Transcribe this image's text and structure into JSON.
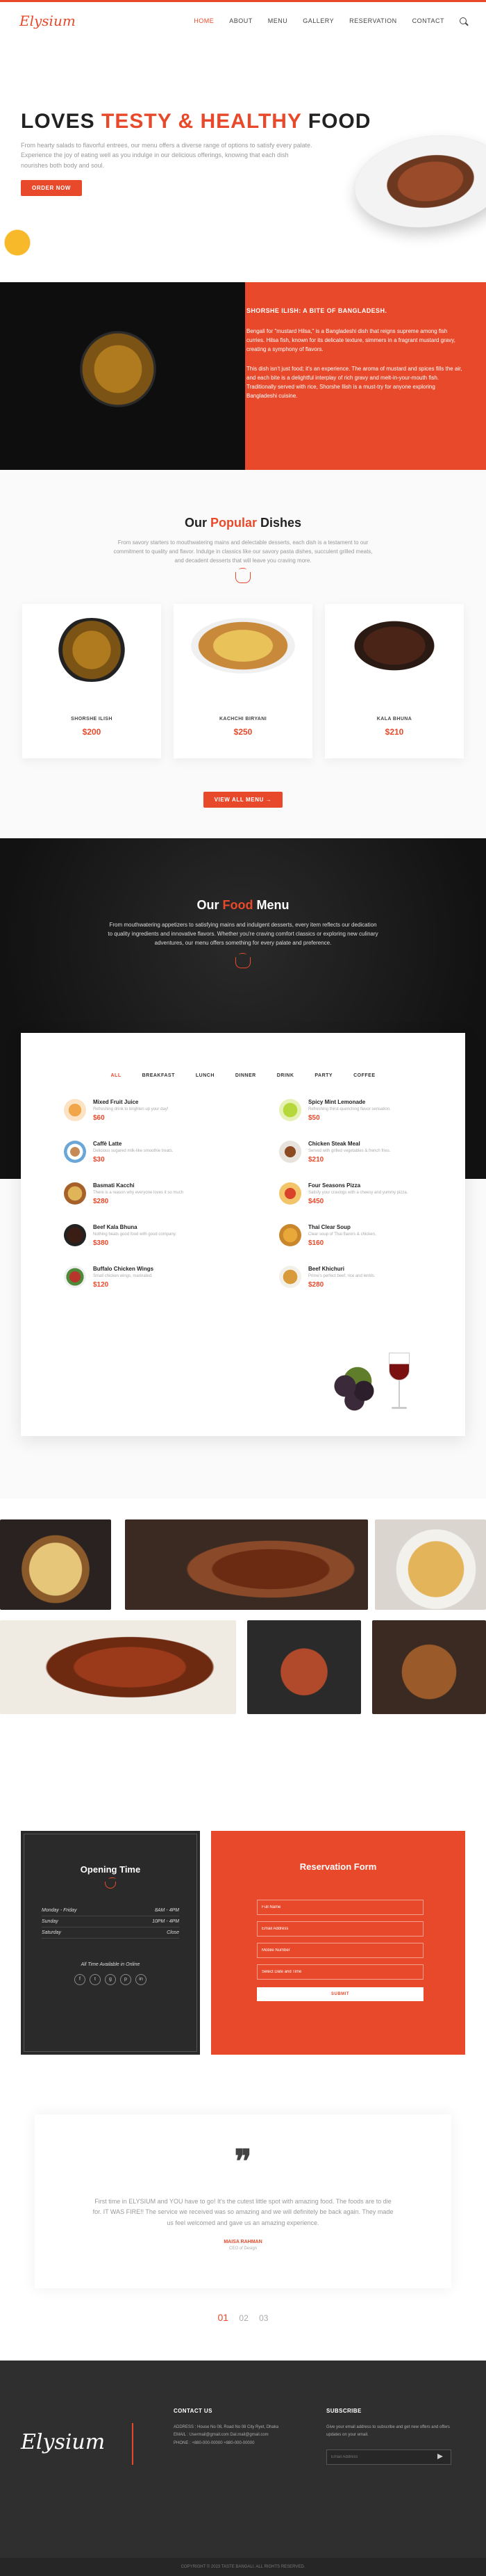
{
  "brand": {
    "logo": "Elysium"
  },
  "nav": {
    "items": [
      "HOME",
      "ABOUT",
      "MENU",
      "GALLERY",
      "RESERVATION",
      "CONTACT"
    ]
  },
  "hero": {
    "title_a": "LOVES ",
    "title_b": "TESTY & HEALTHY",
    "title_c": " FOOD",
    "text": "From hearty salads to flavorful entrees, our menu offers a diverse range of options to satisfy every palate. Experience the joy of eating well as you indulge in our delicious offerings, knowing that each dish nourishes both body and soul.",
    "button": "ORDER NOW"
  },
  "feature": {
    "title": "SHORSHE ILISH: A BITE OF BANGLADESH.",
    "p1": "Bengali for \"mustard Hilsa,\" is a Bangladeshi dish that reigns supreme among fish curries. Hilsa fish, known for its delicate texture, simmers in a fragrant mustard gravy, creating a symphony of flavors.",
    "p2": "This dish isn't just food; it's an experience. The aroma of mustard and spices fills the air, and each bite is a delightful interplay of rich gravy and melt-in-your-mouth fish. Traditionally served with rice, Shorshe Ilish is a must-try for anyone exploring Bangladeshi cuisine."
  },
  "popular": {
    "title_a": "Our ",
    "title_b": "Popular",
    "title_c": " Dishes",
    "desc": "From savory starters to mouthwatering mains and delectable desserts, each dish is a testament to our commitment to quality and flavor. Indulge in classics like our savory pasta dishes, succulent grilled meats, and decadent desserts that will leave you craving more.",
    "dishes": [
      {
        "name": "SHORSHE ILISH",
        "price": "$200"
      },
      {
        "name": "KACHCHI BIRYANI",
        "price": "$250"
      },
      {
        "name": "KALA BHUNA",
        "price": "$210"
      }
    ],
    "button": "VIEW ALL MENU →"
  },
  "food_menu": {
    "title_a": "Our ",
    "title_b": "Food",
    "title_c": " Menu",
    "desc": "From mouthwatering appetizers to satisfying mains and indulgent desserts, every item reflects our dedication to quality ingredients and innovative flavors. Whether you're craving comfort classics or exploring new culinary adventures, our menu offers something for every palate and preference.",
    "tabs": [
      "ALL",
      "BREAKFAST",
      "LUNCH",
      "DINNER",
      "DRINK",
      "PARTY",
      "COFFEE"
    ],
    "items": [
      {
        "name": "Mixed Fruit Juice",
        "desc": "Refreshing drink to brighten up your day!",
        "price": "$60"
      },
      {
        "name": "Spicy Mint Lemonade",
        "desc": "Refreshing thirst-quenching flavor sensation.",
        "price": "$50"
      },
      {
        "name": "Caffè Latte",
        "desc": "Delicious sugared milk-like smoothie treats.",
        "price": "$30"
      },
      {
        "name": "Chicken Steak Meal",
        "desc": "Served with grilled vegetables & french fries.",
        "price": "$210"
      },
      {
        "name": "Basmati Kacchi",
        "desc": "There is a reason why everyone loves it so much",
        "price": "$280"
      },
      {
        "name": "Four Seasons Pizza",
        "desc": "Satisfy your cravings with a cheesy and yummy pizza.",
        "price": "$450"
      },
      {
        "name": "Beef Kala Bhuna",
        "desc": "Nothing beats good food with good company.",
        "price": "$380"
      },
      {
        "name": "Thai Clear Soup",
        "desc": "Clear soup of Thai flavors & chicken.",
        "price": "$160"
      },
      {
        "name": "Buffalo Chicken Wings",
        "desc": "Small chicken wings, marinated.",
        "price": "$120"
      },
      {
        "name": "Beef Khichuri",
        "desc": "Prime's perfect beef, rice and lentils.",
        "price": "$280"
      }
    ]
  },
  "opening": {
    "title": "Opening Time",
    "hours": [
      {
        "day": "Monday - Friday",
        "time": "8AM - 4PM"
      },
      {
        "day": "Sunday",
        "time": "10PM - 4PM"
      },
      {
        "day": "Saturday",
        "time": "Close"
      }
    ],
    "online": "All Time Available in Online",
    "socials": [
      "f",
      "t",
      "g",
      "p",
      "in"
    ]
  },
  "reservation": {
    "title": "Reservation Form",
    "fields": [
      "Full Name",
      "Email Address",
      "Mobile Number",
      "Select Date and Time"
    ],
    "submit": "SUBMIT"
  },
  "testimonial": {
    "quote": "First time in ELYSIUM and YOU have to go! It's the cutest little spot with amazing food. The foods are to die for. IT WAS FIRE!! The service we received was so amazing and we will definitely be back again. They made us feel welcomed and gave us an amazing experience.",
    "name": "MAISA RAHMAN",
    "role": "CEO of Design",
    "pager": [
      "01",
      "02",
      "03"
    ]
  },
  "footer": {
    "logo": "Elysium",
    "contact_title": "CONTACT US",
    "address": "ADDRESS : House No 08, Road No 08 City Ryet, Dhaka",
    "email": "EMAIL : Usermail@gmail.com Dal.mail@gmail.com",
    "phone": "PHONE : +880-000-00000 +880-000-00000",
    "subscribe_title": "SUBSCRIBE",
    "subscribe_text": "Give your email address to subscribe and get new offers and offers updates on your email.",
    "subscribe_placeholder": "Email Address",
    "copyright": "COPYRIGHT © 2023 TASTE BANGALI. ALL RIGHTS RESERVED."
  }
}
